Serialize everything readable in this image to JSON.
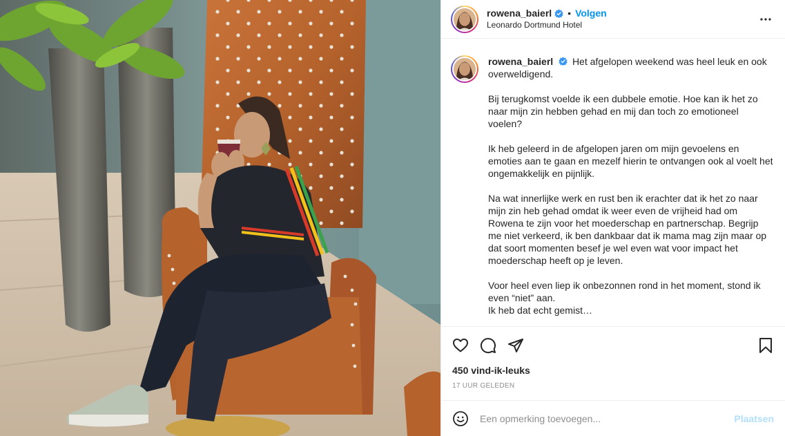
{
  "post": {
    "username": "rowena_baierl",
    "follow_label": "Volgen",
    "separator": "•",
    "location": "Leonardo Dortmund Hotel",
    "more_label": "•••",
    "caption_paragraphs": [
      "Het afgelopen weekend was heel leuk en ook overweldigend.",
      "Bij terugkomst voelde ik een dubbele emotie. Hoe kan ik het zo naar mijn zin hebben gehad en mij dan toch zo emotioneel voelen?",
      "Ik heb geleerd in de afgelopen jaren om mijn gevoelens en emoties aan te gaan en mezelf hierin te ontvangen ook al voelt het ongemakkelijk en pijnlijk.",
      "Na wat innerlijke werk en rust ben ik erachter dat ik het zo naar mijn zin heb gehad omdat ik weer even de vrijheid had om Rowena te zijn voor het moederschap en partnerschap. Begrijp me niet verkeerd, ik ben dankbaar dat ik mama mag zijn maar op dat soort momenten besef je wel even wat voor impact het moederschap heeft op je leven.",
      "Voor heel even liep ik onbezonnen rond in het moment, stond ik even “niet” aan.",
      "Ik heb dat echt gemist…"
    ],
    "likes": "450 vind-ik-leuks",
    "time": "17 UUR GELEDEN",
    "comment_placeholder": "Een opmerking toevoegen...",
    "post_button": "Plaatsen"
  },
  "icons": {
    "verified": "verified-badge-icon",
    "like": "heart-icon",
    "comment": "comment-icon",
    "share": "send-icon",
    "save": "bookmark-icon",
    "emoji": "emoji-icon",
    "more": "more-options-icon"
  },
  "colors": {
    "link_blue": "#0095f6",
    "post_button_disabled": "#b2dffc",
    "chair_orange": "#b8612a",
    "wall_teal": "#6f8e8e"
  }
}
